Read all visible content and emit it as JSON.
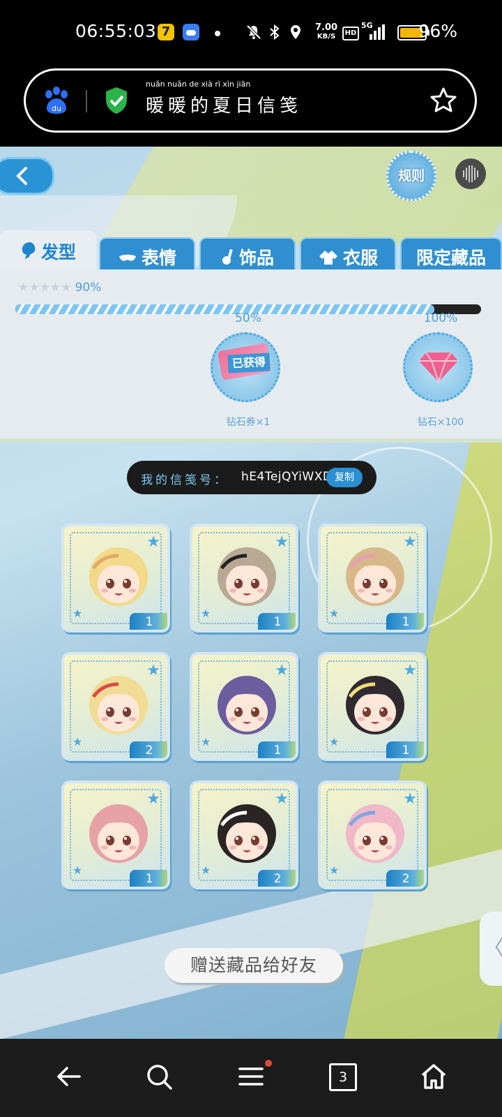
{
  "status_bar": {
    "time": "06:55:03",
    "app_badge": "7",
    "net_speed_value": "7.00",
    "net_speed_unit": "KB/S",
    "hd_label": "HD",
    "signal_label": "5G",
    "battery_text": "96%",
    "battery_level": 0.96
  },
  "browser": {
    "page_title": "暖暖的夏日信笺",
    "page_title_pinyin": "nuǎn nuǎn de xià rì xìn jiān",
    "secure": true
  },
  "page": {
    "rules_label": "规则",
    "tabs": [
      {
        "label": "发型",
        "icon": "hair-icon",
        "active": true
      },
      {
        "label": "表情",
        "icon": "mask-icon",
        "active": false
      },
      {
        "label": "饰品",
        "icon": "accessory-icon",
        "active": false
      },
      {
        "label": "衣服",
        "icon": "clothes-icon",
        "active": false
      },
      {
        "label": "限定藏品",
        "icon": "",
        "active": false
      }
    ],
    "progress": {
      "percent_text": "90%",
      "value": 0.9,
      "milestones": [
        {
          "label": "50%",
          "reward": "钻石券×1",
          "status": "已获得",
          "icon": "ticket-icon"
        },
        {
          "label": "100%",
          "reward": "钻石×100",
          "status": "",
          "icon": "diamond-icon"
        }
      ]
    },
    "gift_code": {
      "label": "我的信笺号：",
      "value": "hE4TejQYiWXD",
      "copy_label": "复制"
    },
    "items": [
      {
        "count": "1",
        "hair": "#f3d98a",
        "accent": "#e0a96a"
      },
      {
        "count": "1",
        "hair": "#b9a893",
        "accent": "#222222"
      },
      {
        "count": "1",
        "hair": "#d8b88a",
        "accent": "#e6a0b0"
      },
      {
        "count": "2",
        "hair": "#f2dc95",
        "accent": "#d94b48"
      },
      {
        "count": "1",
        "hair": "#6b5d9e",
        "accent": "#6b5d9e"
      },
      {
        "count": "1",
        "hair": "#2e2a30",
        "accent": "#f3dc7a"
      },
      {
        "count": "1",
        "hair": "#e7a2a6",
        "accent": "#e7a2a6"
      },
      {
        "count": "2",
        "hair": "#2b2424",
        "accent": "#ffffff"
      },
      {
        "count": "2",
        "hair": "#f0b8c8",
        "accent": "#7fa6e0"
      }
    ],
    "gift_button": "赠送藏品给好友",
    "side_tab_glyph": "〈"
  },
  "navbar": {
    "tab_count": "3"
  },
  "colors": {
    "accent_blue": "#2a8fd3",
    "progress_fill": "#7ec6f2",
    "nav_bg": "#1c1c1c"
  }
}
